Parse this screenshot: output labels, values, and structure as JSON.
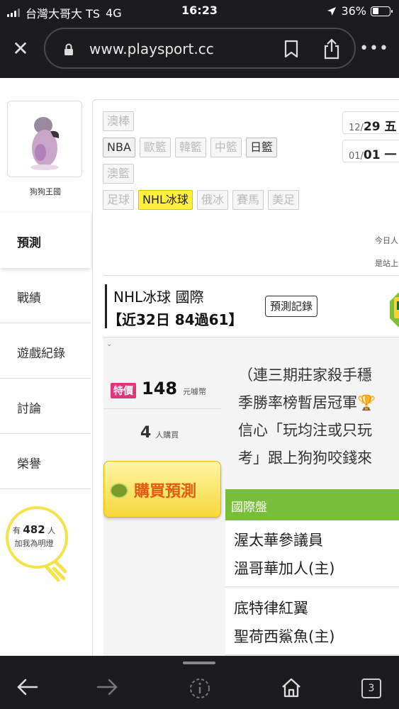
{
  "status": {
    "carrier": "台灣大哥大 TS",
    "network": "4G",
    "time": "16:23",
    "battery": "36%"
  },
  "browser": {
    "url": "www.playsport.cc"
  },
  "profile": {
    "name": "狗狗王國"
  },
  "menu": {
    "active": "預測",
    "items": [
      "戰績",
      "遊戲紀錄",
      "討論",
      "榮譽"
    ]
  },
  "lightbulb": {
    "prefix": "有",
    "count": "482",
    "suffix": "人",
    "caption": "加我為明燈"
  },
  "categories": {
    "row1": [
      {
        "label": "澳棒",
        "state": "off"
      }
    ],
    "row2": [
      {
        "label": "NBA",
        "state": "on"
      },
      {
        "label": "歐籃",
        "state": "off"
      },
      {
        "label": "韓籃",
        "state": "off"
      },
      {
        "label": "中籃",
        "state": "off"
      },
      {
        "label": "日籃",
        "state": "on"
      }
    ],
    "row3": [
      {
        "label": "澳籃",
        "state": "off"
      }
    ],
    "row4": [
      {
        "label": "足球",
        "state": "off"
      },
      {
        "label": "NHL冰球",
        "state": "sel"
      },
      {
        "label": "俄冰",
        "state": "off"
      },
      {
        "label": "賽馬",
        "state": "off"
      },
      {
        "label": "美足",
        "state": "off"
      }
    ]
  },
  "dates": [
    {
      "prefix": "12/",
      "day": "29",
      "weekday": " 五"
    },
    {
      "prefix": "01/",
      "day": "01",
      "weekday": " 一"
    }
  ],
  "notes": [
    "今日人",
    "是站上"
  ],
  "header": {
    "title": "NHL冰球 國際",
    "record": "【近32日 84過61】",
    "record_button": "預測記錄"
  },
  "pricing": {
    "special_label": "特價",
    "price": "148",
    "unit": "元噱幣",
    "buyers": "4",
    "buyers_unit": "人購買",
    "buy_button": "購買預測"
  },
  "description": [
    "（連三期莊家殺手穩",
    "季勝率榜暫居冠軍🏆",
    "信心「玩均注或只玩",
    "考」跟上狗狗咬錢來"
  ],
  "market": {
    "label": "國際盤"
  },
  "matches": [
    {
      "away": "渥太華參議員",
      "home": "溫哥華加人(主)"
    },
    {
      "away": "底特律紅翼",
      "home": "聖荷西鯊魚(主)"
    }
  ],
  "toolbar": {
    "tabs": "3"
  }
}
